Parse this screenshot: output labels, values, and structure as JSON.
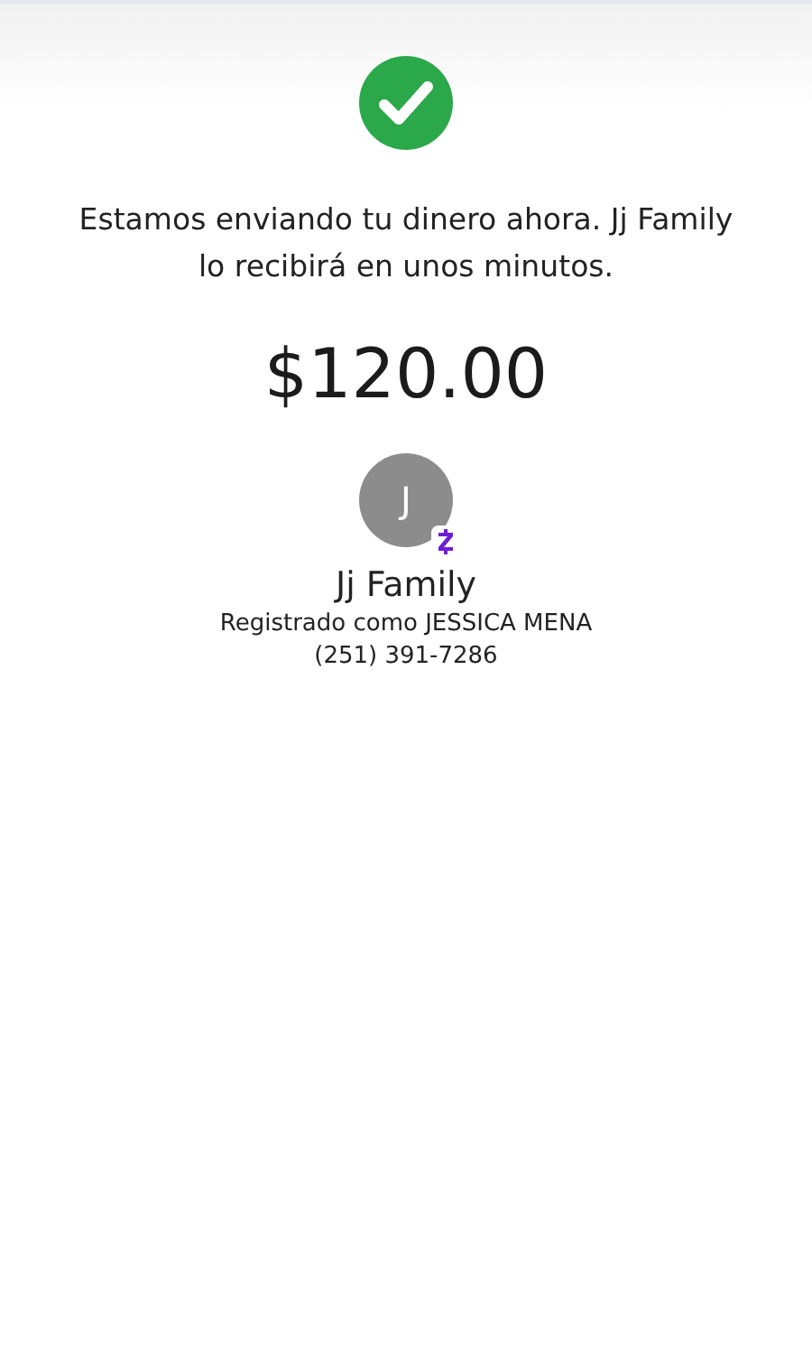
{
  "message": "Estamos enviando tu dinero ahora. Jj Family lo recibirá en unos minutos.",
  "amount": "$120.00",
  "recipient": {
    "initial": "J",
    "name": "Jj Family",
    "registered": "Registrado como JESSICA MENA",
    "phone": "(251) 391-7286"
  }
}
